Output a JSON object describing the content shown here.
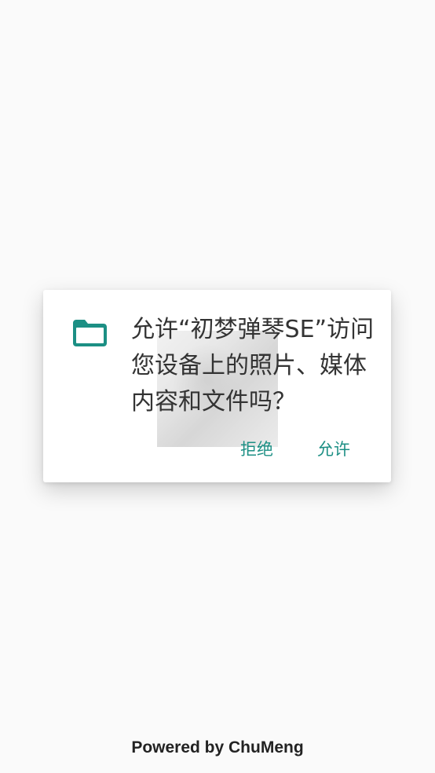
{
  "dialog": {
    "message": "允许“初梦弹琴SE”访问您设备上的照片、媒体内容和文件吗？",
    "deny_label": "拒绝",
    "allow_label": "允许",
    "icon": "folder-icon"
  },
  "footer": {
    "text": "Powered by ChuMeng"
  },
  "colors": {
    "background": "#fafafa",
    "dialog": "#ffffff",
    "accent": "#1c8f84",
    "text": "#333333"
  }
}
